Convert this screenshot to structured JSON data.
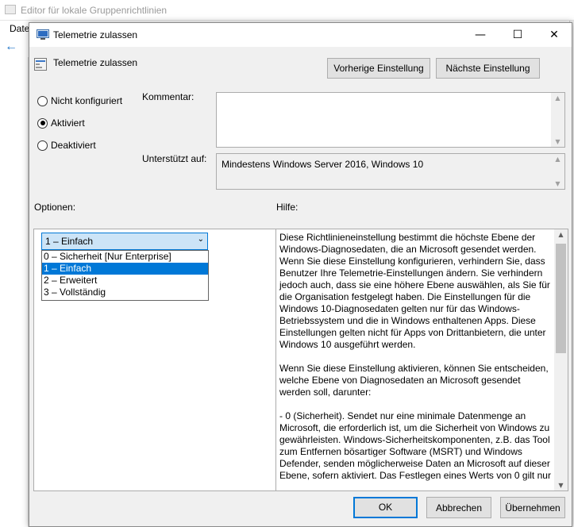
{
  "background_window": {
    "title": "Editor für lokale Gruppenrichtlinien",
    "menu_first": "Date"
  },
  "dialog": {
    "title": "Telemetrie zulassen",
    "header_title": "Telemetrie zulassen",
    "prev_button": "Vorherige Einstellung",
    "next_button": "Nächste Einstellung",
    "radios": [
      {
        "label": "Nicht konfiguriert",
        "checked": false
      },
      {
        "label": "Aktiviert",
        "checked": true
      },
      {
        "label": "Deaktiviert",
        "checked": false
      }
    ],
    "comment_label": "Kommentar:",
    "supported_label": "Unterstützt auf:",
    "supported_value": "Mindestens Windows Server 2016, Windows 10",
    "options_label": "Optionen:",
    "help_label": "Hilfe:",
    "combo_value": "1 – Einfach",
    "dropdown_options": [
      "0 – Sicherheit [Nur Enterprise]",
      "1 – Einfach",
      "2 – Erweitert",
      "3 – Vollständig"
    ],
    "dropdown_selected_index": 1,
    "help_paragraphs": [
      "Diese Richtlinieneinstellung bestimmt die höchste Ebene der Windows-Diagnosedaten, die an Microsoft gesendet werden. Wenn Sie diese Einstellung konfigurieren, verhindern Sie, dass Benutzer Ihre Telemetrie-Einstellungen ändern. Sie verhindern jedoch auch, dass sie eine höhere Ebene auswählen, als Sie für die Organisation festgelegt haben. Die Einstellungen  für die Windows 10-Diagnosedaten gelten nur für das Windows-Betriebssystem und die in Windows enthaltenen Apps. Diese Einstellungen gelten nicht für Apps von Drittanbietern, die unter Windows 10 ausgeführt werden.",
      "Wenn Sie diese Einstellung aktivieren, können Sie entscheiden, welche Ebene von Diagnosedaten an Microsoft gesendet werden soll, darunter:",
      "  - 0 (Sicherheit). Sendet nur eine minimale Datenmenge an Microsoft, die erforderlich ist, um die Sicherheit von Windows zu gewährleisten. Windows-Sicherheitskomponenten, z.B. das Tool zum Entfernen bösartiger Software (MSRT) und Windows Defender, senden möglicherweise Daten an Microsoft auf dieser Ebene, sofern aktiviert. Das Festlegen eines Werts von 0 gilt nur"
    ],
    "ok_button": "OK",
    "cancel_button": "Abbrechen",
    "apply_button": "Übernehmen"
  },
  "colors": {
    "accent": "#0078d7",
    "dialog_bg": "#f0f0f0",
    "button_bg": "#e1e1e1",
    "combo_bg": "#cce4f7"
  }
}
